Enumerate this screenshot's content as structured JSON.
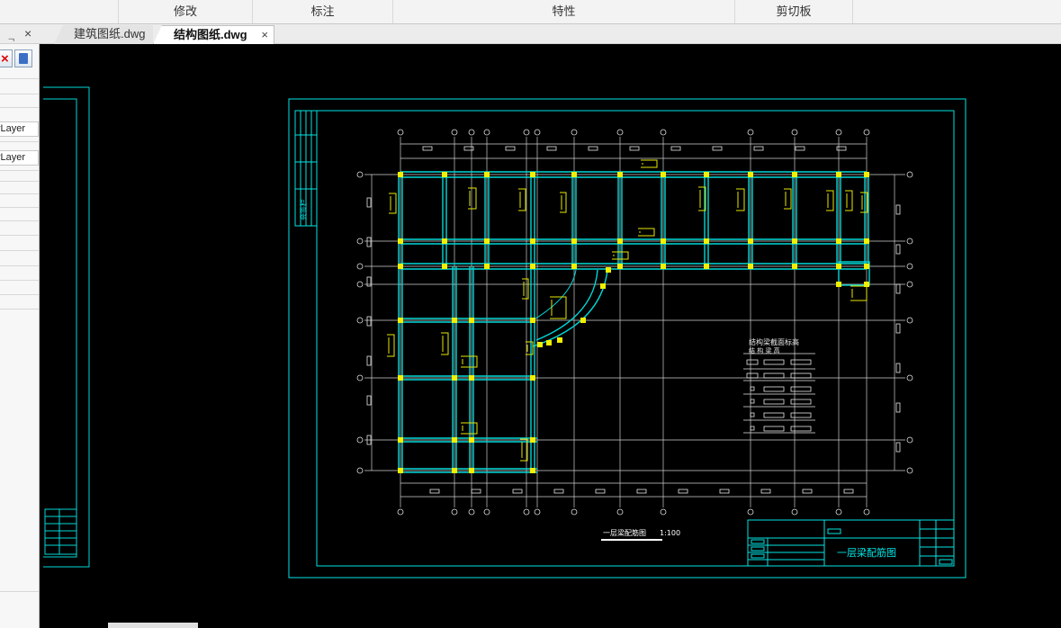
{
  "ribbon": {
    "groups": [
      {
        "label": "修改"
      },
      {
        "label": "标注"
      },
      {
        "label": "特性"
      },
      {
        "label": "剪切板"
      }
    ]
  },
  "tabs": {
    "inactive_label": "建筑图纸.dwg",
    "active_label": "结构图纸.dwg",
    "close_glyph": "×"
  },
  "panel": {
    "pin_glyph": "ᆨ",
    "close_glyph": "×",
    "values": [
      "yLayer",
      "yLayer"
    ]
  },
  "drawing": {
    "title": "一层梁配筋图",
    "scale": "1:100",
    "legend_title": "结构梁截面标高",
    "legend_header": "结  构  梁  高",
    "titleblock_name": "一层梁配筋图",
    "side_stamp": "会签栏"
  },
  "colors": {
    "frame": "#00e5e5",
    "line": "#d8d8d8",
    "column": "#f0f000",
    "rebar": "#e8e800"
  }
}
